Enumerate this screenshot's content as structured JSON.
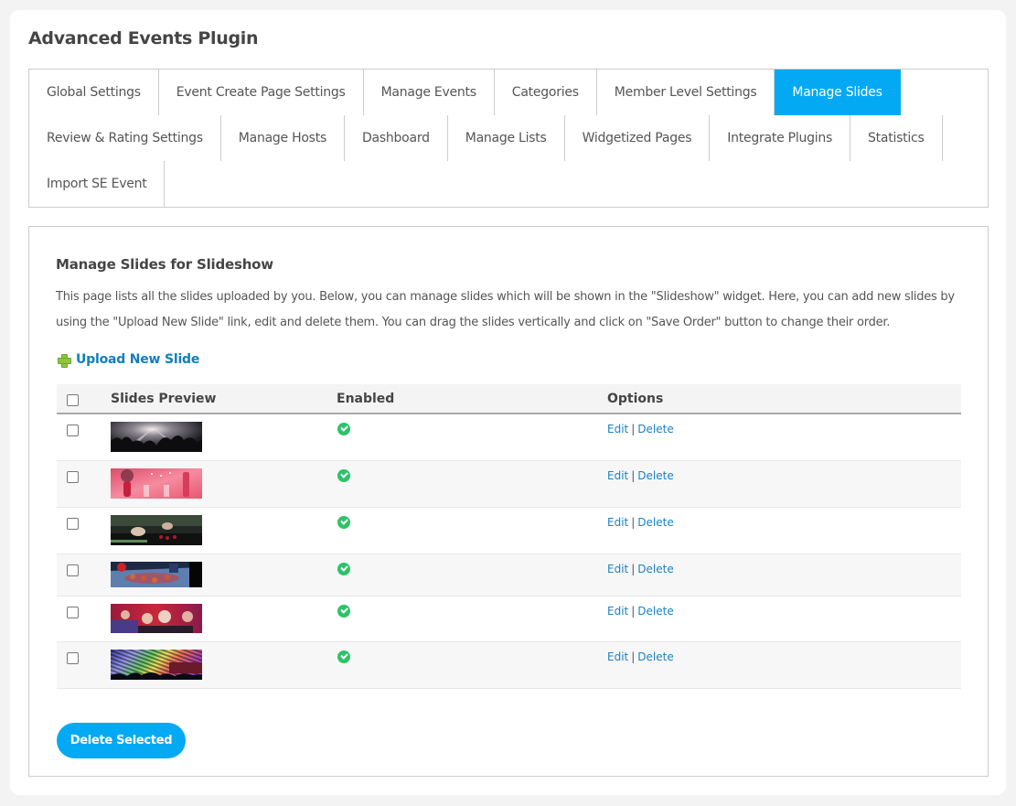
{
  "app": {
    "title": "Advanced Events Plugin"
  },
  "tabs": {
    "row1": [
      {
        "label": "Global Settings",
        "active": false
      },
      {
        "label": "Event Create Page Settings",
        "active": false
      },
      {
        "label": "Manage Events",
        "active": false
      },
      {
        "label": "Categories",
        "active": false
      },
      {
        "label": "Member Level Settings",
        "active": false
      },
      {
        "label": "Manage Slides",
        "active": true
      }
    ],
    "row2": [
      {
        "label": "Review & Rating Settings",
        "active": false
      },
      {
        "label": "Manage Hosts",
        "active": false
      },
      {
        "label": "Dashboard",
        "active": false
      },
      {
        "label": "Manage Lists",
        "active": false
      },
      {
        "label": "Widgetized Pages",
        "active": false
      },
      {
        "label": "Integrate Plugins",
        "active": false
      },
      {
        "label": "Statistics",
        "active": false
      }
    ],
    "row3": [
      {
        "label": "Import SE Event",
        "active": false
      }
    ]
  },
  "main": {
    "title": "Manage Slides for Slideshow",
    "description": "This page lists all the slides uploaded by you. Below, you can manage slides which will be shown in the \"Slideshow\" widget. Here, you can add new slides by using the \"Upload New Slide\" link, edit and delete them. You can drag the slides vertically and click on \"Save Order\" button to change their order.",
    "upload_link": "Upload New Slide",
    "upload_icon": "plus-icon",
    "table": {
      "headers": {
        "preview": "Slides Preview",
        "enabled": "Enabled",
        "options": "Options"
      },
      "rows": [
        {
          "preview": "concert-crowd-lights",
          "enabled": true,
          "edit": "Edit",
          "delete": "Delete"
        },
        {
          "preview": "pink-party-table",
          "enabled": true,
          "edit": "Edit",
          "delete": "Delete"
        },
        {
          "preview": "dj-turntables",
          "enabled": true,
          "edit": "Edit",
          "delete": "Delete"
        },
        {
          "preview": "party-drinks-table",
          "enabled": true,
          "edit": "Edit",
          "delete": "Delete"
        },
        {
          "preview": "masked-party-people",
          "enabled": true,
          "edit": "Edit",
          "delete": "Delete"
        },
        {
          "preview": "rainbow-light-club",
          "enabled": true,
          "edit": "Edit",
          "delete": "Delete"
        }
      ],
      "separator": "|"
    },
    "delete_selected": "Delete Selected"
  },
  "colors": {
    "accent": "#04a9f4",
    "link": "#1b82c5",
    "enabled": "#2ec26a",
    "plus": "#8dc63f"
  }
}
